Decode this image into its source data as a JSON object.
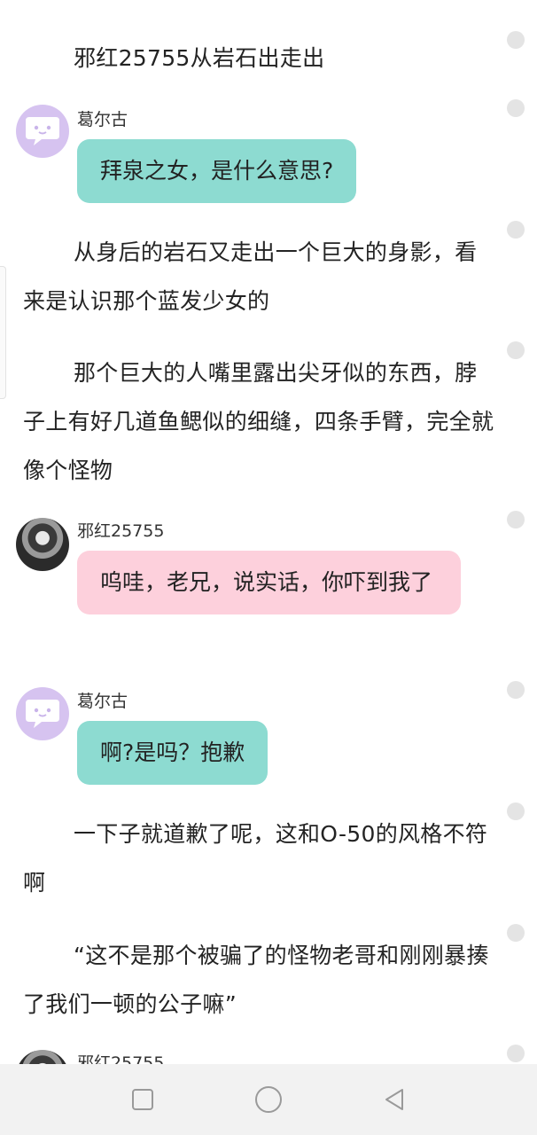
{
  "story": {
    "paragraphs": [
      "邪红25755从岩石出走出",
      "从身后的岩石又走出一个巨大的身影，看来是认识那个蓝发少女的",
      "那个巨大的人嘴里露出尖牙似的东西，脖子上有好几道鱼鳃似的细缝，四条手臂，完全就像个怪物",
      "一下子就道歉了呢，这和O-50的风格不符啊",
      "“这不是那个被骗了的怪物老哥和刚刚暴揍了我们一顿的公子嘛”"
    ],
    "messages": [
      {
        "speaker": "葛尔古",
        "text": "拜泉之女，是什么意思?"
      },
      {
        "speaker": "邪红25755",
        "text": "呜哇，老兄，说实话，你吓到我了"
      },
      {
        "speaker": "葛尔古",
        "text": "啊?是吗？抱歉"
      },
      {
        "speaker": "邪红25755",
        "text": ""
      }
    ]
  },
  "icons": {
    "bot_avatar": "chat-bubble-face-icon",
    "user_avatar": "dark-haired-portrait",
    "nav_recent": "square-icon",
    "nav_home": "circle-icon",
    "nav_back": "triangle-back-icon"
  },
  "colors": {
    "bubble_bot": "#8ddbd1",
    "bubble_user": "#fdd0dc",
    "avatar_bot": "#d6c3f0",
    "navbar_bg": "#f2f2f2"
  }
}
